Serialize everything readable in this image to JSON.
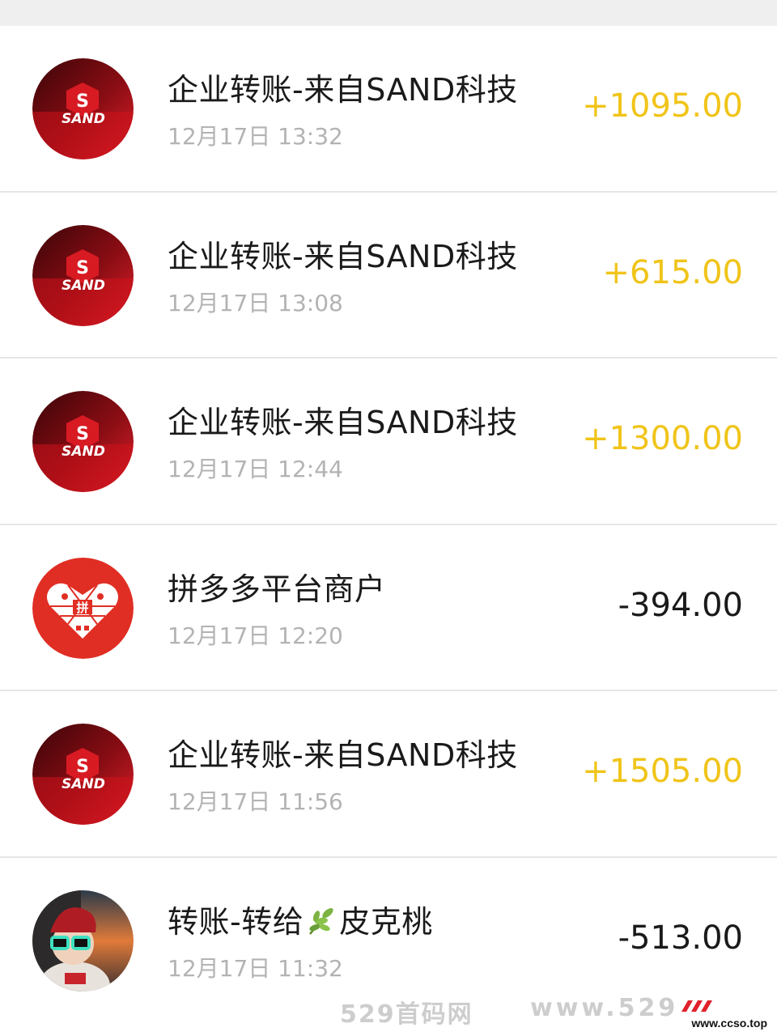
{
  "transactions": [
    {
      "title": "企业转账-来自SAND科技",
      "time": "12月17日 13:32",
      "amount": "+1095.00",
      "direction": "in",
      "avatar": "sand-logo"
    },
    {
      "title": "企业转账-来自SAND科技",
      "time": "12月17日 13:08",
      "amount": "+615.00",
      "direction": "in",
      "avatar": "sand-logo"
    },
    {
      "title": "企业转账-来自SAND科技",
      "time": "12月17日 12:44",
      "amount": "+1300.00",
      "direction": "in",
      "avatar": "sand-logo"
    },
    {
      "title": "拼多多平台商户",
      "time": "12月17日 12:20",
      "amount": "-394.00",
      "direction": "out",
      "avatar": "pinduoduo-logo"
    },
    {
      "title": "企业转账-来自SAND科技",
      "time": "12月17日 11:56",
      "amount": "+1505.00",
      "direction": "in",
      "avatar": "sand-logo"
    },
    {
      "title_prefix": "转账-转给",
      "title_suffix": "皮克桃",
      "time": "12月17日 11:32",
      "amount": "-513.00",
      "direction": "out",
      "avatar": "user-photo"
    }
  ],
  "sand_logo_text": "SAND",
  "pdd_logo_text": "拼",
  "watermark": {
    "name": "529首码网",
    "url": "www.529",
    "site": "www.ccso.top"
  },
  "colors": {
    "income": "#f0c419",
    "expense": "#1a1a1a",
    "time": "#b3b3b3",
    "sand_red": "#d0121b",
    "pdd_red": "#e02e24"
  }
}
